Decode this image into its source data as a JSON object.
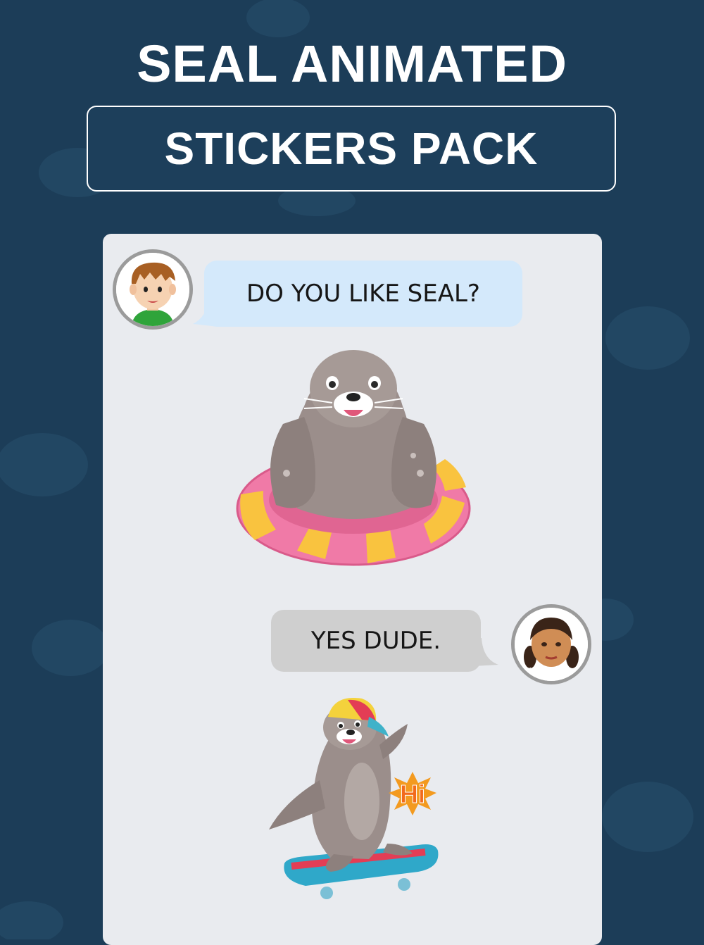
{
  "header": {
    "title": "SEAL ANIMATED",
    "subtitle": "STICKERS PACK"
  },
  "chat": {
    "messages": [
      {
        "sender": "boy-avatar",
        "text": "DO YOU LIKE SEAL?"
      },
      {
        "sender": "girl-avatar",
        "text": "YES DUDE."
      }
    ],
    "stickers": [
      {
        "name": "seal-on-swim-ring-sticker"
      },
      {
        "name": "seal-skateboard-sticker",
        "caption": "Hi"
      }
    ]
  },
  "colors": {
    "background": "#1c3d58",
    "panel": "#e9ebef",
    "bubble_blue": "#d4e9fb",
    "bubble_gray": "#cfcfcf",
    "text_white": "#ffffff"
  }
}
